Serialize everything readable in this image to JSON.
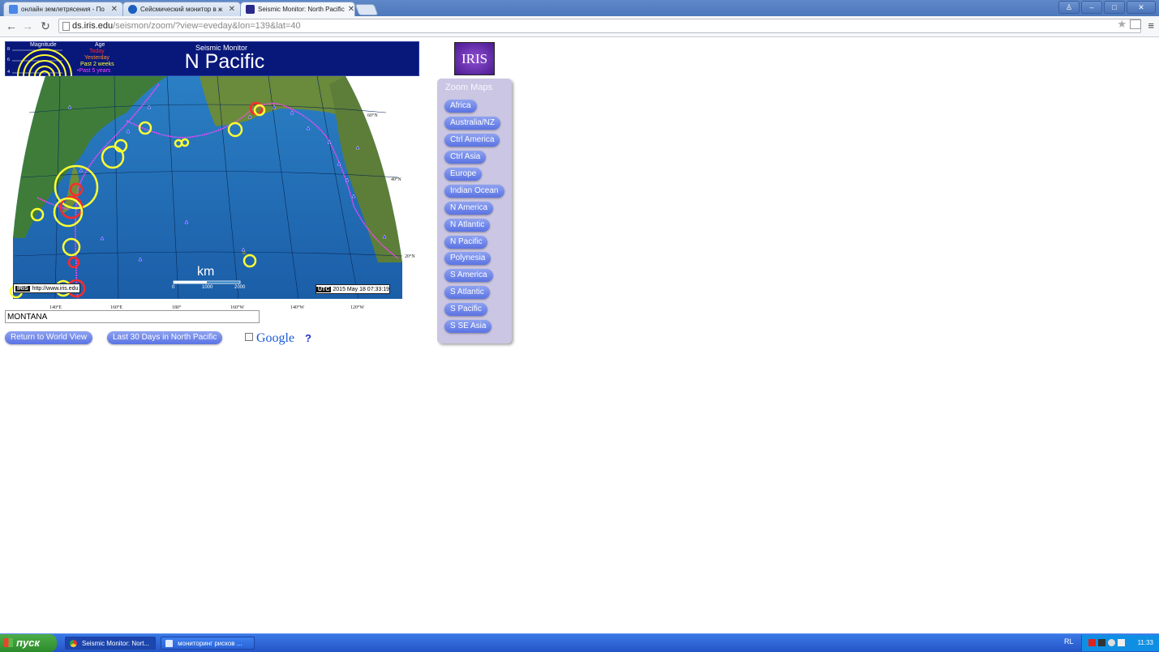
{
  "browser": {
    "tabs": [
      {
        "label": "онлайн землетрясения - По",
        "icon": "google-favicon",
        "color": "#4a86e8"
      },
      {
        "label": "Сейсмический монитор в ж",
        "icon": "globe-favicon",
        "color": "#1b5fbf"
      },
      {
        "label": "Seismic Monitor: North Pacific",
        "icon": "iris-favicon",
        "color": "#2a2a8a"
      }
    ],
    "url_host": "ds.iris.edu",
    "url_path": "/seismon/zoom/?view=eveday&lon=139&lat=40",
    "window_buttons": [
      "restore-user",
      "minimize",
      "maximize",
      "close"
    ]
  },
  "map": {
    "header_small": "Seismic Monitor",
    "region_title": "N Pacific",
    "magnitude_label": "Magnitude",
    "magnitude_values": [
      "8",
      "6",
      "4"
    ],
    "age_label": "Age",
    "age_legend": [
      {
        "label": "Today",
        "color": "#ff2a2a"
      },
      {
        "label": "Yesterday",
        "color": "#ff8a2a"
      },
      {
        "label": "Past 2 weeks",
        "color": "#ffff33"
      },
      {
        "label": "•Past 5 years",
        "color": "#ff44ff"
      }
    ],
    "lat_labels": [
      "60°N",
      "40°N",
      "20°N"
    ],
    "lon_labels": [
      "140°E",
      "160°E",
      "180°",
      "160°W",
      "140°W",
      "120°W"
    ],
    "scale_unit": "km",
    "scale_ticks": [
      "0",
      "1000",
      "2000"
    ],
    "iris_badge": "IRIS",
    "iris_url": "http://www.iris.edu",
    "utc_label": "UTC",
    "timestamp": "2015 May 18 07:33:19"
  },
  "controls": {
    "search_value": "MONTANA",
    "return_button": "Return to World View",
    "last30_button": "Last 30 Days in North Pacific",
    "google_label": "Google",
    "help_label": "?"
  },
  "logo_text": "IRIS",
  "zoom_panel": {
    "title": "Zoom Maps",
    "items": [
      "Africa",
      "Australia/NZ",
      "Ctrl America",
      "Ctrl Asia",
      "Europe",
      "Indian Ocean",
      "N America",
      "N Atlantic",
      "N Pacific",
      "Polynesia",
      "S America",
      "S Atlantic",
      "S Pacific",
      "S SE Asia"
    ]
  },
  "taskbar": {
    "start_label": "пуск",
    "tasks": [
      "Seismic Monitor: Nort...",
      "мониторинг рисков ..."
    ],
    "language": "RL",
    "clock": "11:33"
  }
}
